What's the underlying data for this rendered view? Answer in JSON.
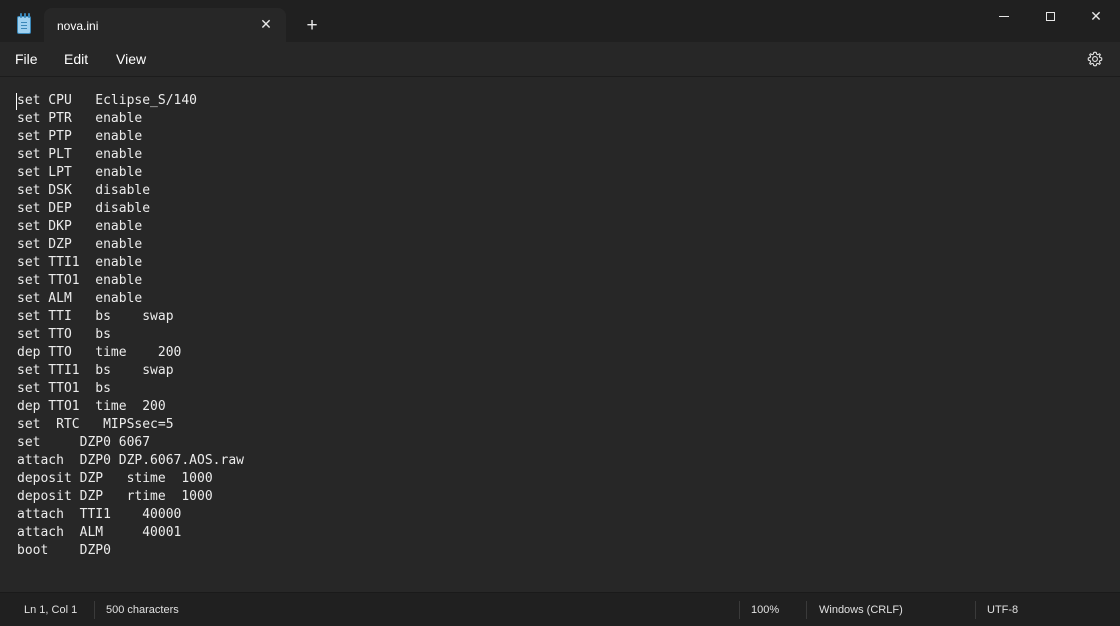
{
  "tab": {
    "title": "nova.ini",
    "close_symbol": "✕",
    "new_tab_symbol": "+"
  },
  "icons": {
    "app": "notepad-icon",
    "minimize": "minimize-icon",
    "maximize": "maximize-icon",
    "close": "close-icon",
    "settings": "gear-icon"
  },
  "window_controls": {
    "close_symbol": "✕"
  },
  "menu": {
    "file": "File",
    "edit": "Edit",
    "view": "View"
  },
  "editor": {
    "content": "set CPU   Eclipse_S/140\nset PTR   enable\nset PTP   enable\nset PLT   enable\nset LPT   enable\nset DSK   disable\nset DEP   disable\nset DKP   enable\nset DZP   enable\nset TTI1  enable\nset TTO1  enable\nset ALM   enable\nset TTI   bs    swap\nset TTO   bs\ndep TTO   time    200\nset TTI1  bs    swap\nset TTO1  bs\ndep TTO1  time  200\nset  RTC   MIPSsec=5\nset     DZP0 6067\nattach  DZP0 DZP.6067.AOS.raw\ndeposit DZP   stime  1000\ndeposit DZP   rtime  1000\nattach  TTI1    40000\nattach  ALM     40001\nboot    DZP0"
  },
  "status": {
    "position": "Ln 1, Col 1",
    "characters": "500 characters",
    "zoom": "100%",
    "line_ending": "Windows (CRLF)",
    "encoding": "UTF-8"
  },
  "colors": {
    "background": "#272727",
    "titlebar": "#202020",
    "text": "#ececec"
  }
}
